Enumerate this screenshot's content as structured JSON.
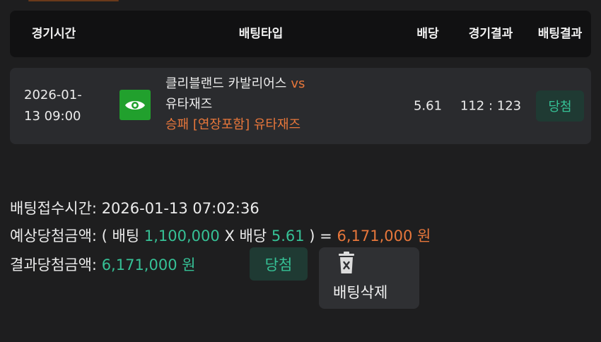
{
  "header": {
    "col_time": "경기시간",
    "col_bet_type": "배팅타입",
    "col_odds": "배당",
    "col_score": "경기결과",
    "col_result": "배팅결과"
  },
  "bet_row": {
    "time_line1": "2026-01-",
    "time_line2": "13 09:00",
    "view_icon": "eye-icon",
    "home_team": "클리블랜드 카발리어스",
    "vs": "vs",
    "away_team": "유타재즈",
    "bet_type": "승패 [연장포함] 유타재즈",
    "odds": "5.61",
    "score": "112 : 123",
    "result": "당첨"
  },
  "details": {
    "accept_label": "배팅접수시간:",
    "accept_time": "2026-01-13 07:02:36",
    "expected_label": "예상당첨금액: ( 배팅",
    "stake": "1,100,000",
    "x_odds_label": "X 배당",
    "odds": "5.61",
    "close_eq": ") =",
    "expected_amount": "6,171,000 원",
    "actual_label": "결과당첨금액:",
    "actual_amount": "6,171,000 원",
    "status_badge": "당첨",
    "delete_label": "배팅삭제",
    "delete_icon": "trash-icon"
  },
  "colors": {
    "accent_green": "#36c196",
    "accent_orange": "#e8773b",
    "view_button_green": "#21a02d",
    "background": "#1e1e1f"
  }
}
